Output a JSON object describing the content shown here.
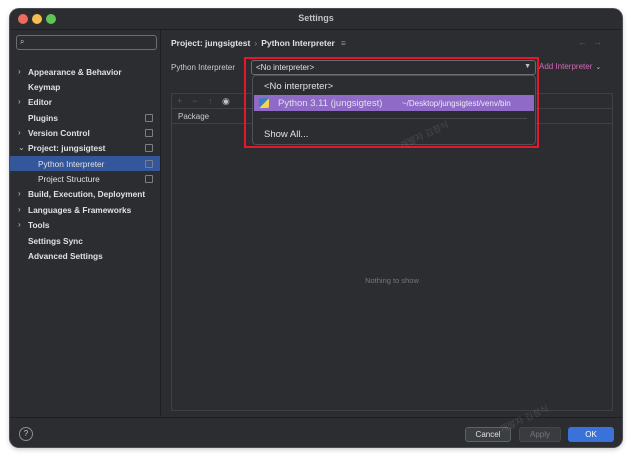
{
  "window": {
    "title": "Settings"
  },
  "sidebar": {
    "search_placeholder": "",
    "items": [
      {
        "label": "Appearance & Behavior",
        "arrow": "›",
        "pill": false,
        "child": false,
        "selected": false
      },
      {
        "label": "Keymap",
        "arrow": "",
        "pill": false,
        "child": false,
        "selected": false
      },
      {
        "label": "Editor",
        "arrow": "›",
        "pill": false,
        "child": false,
        "selected": false
      },
      {
        "label": "Plugins",
        "arrow": "",
        "pill": true,
        "child": false,
        "selected": false
      },
      {
        "label": "Version Control",
        "arrow": "›",
        "pill": true,
        "child": false,
        "selected": false
      },
      {
        "label": "Project: jungsigtest",
        "arrow": "⌄",
        "pill": true,
        "child": false,
        "selected": false
      },
      {
        "label": "Python Interpreter",
        "arrow": "",
        "pill": true,
        "child": true,
        "selected": true
      },
      {
        "label": "Project Structure",
        "arrow": "",
        "pill": true,
        "child": true,
        "selected": false
      },
      {
        "label": "Build, Execution, Deployment",
        "arrow": "›",
        "pill": false,
        "child": false,
        "selected": false
      },
      {
        "label": "Languages & Frameworks",
        "arrow": "›",
        "pill": false,
        "child": false,
        "selected": false
      },
      {
        "label": "Tools",
        "arrow": "›",
        "pill": false,
        "child": false,
        "selected": false
      },
      {
        "label": "Settings Sync",
        "arrow": "",
        "pill": false,
        "child": false,
        "selected": false
      },
      {
        "label": "Advanced Settings",
        "arrow": "",
        "pill": false,
        "child": false,
        "selected": false
      }
    ]
  },
  "breadcrumb": {
    "project": "Project: jungsigtest",
    "separator": "›",
    "page": "Python Interpreter"
  },
  "interpreter": {
    "label": "Python Interpreter",
    "value": "<No interpreter>",
    "add_label": "Add Interpreter"
  },
  "table": {
    "column_package": "Package",
    "empty_text": "Nothing to show"
  },
  "popup": {
    "item_none": "<No interpreter>",
    "item_python_name": "Python 3.11 (jungsigtest)",
    "item_python_path": "~/Desktop/jungsigtest/venv/bin",
    "item_show_all": "Show All..."
  },
  "footer": {
    "help": "?",
    "cancel": "Cancel",
    "apply": "Apply",
    "ok": "OK"
  },
  "watermark": "개발자 김정식",
  "colors": {
    "accent": "#3a72d9",
    "selection": "#34569a",
    "popup_highlight": "#8f6ac7",
    "add_link": "#d26ab8",
    "red_frame": "#e3182a"
  }
}
